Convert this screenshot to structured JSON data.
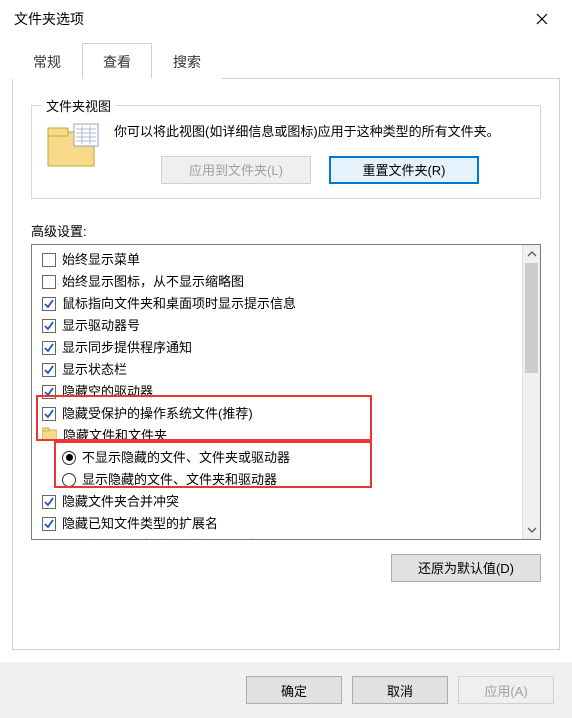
{
  "title": "文件夹选项",
  "tabs": {
    "general": "常规",
    "view": "查看",
    "search": "搜索"
  },
  "group": {
    "label": "文件夹视图",
    "desc": "你可以将此视图(如详细信息或图标)应用于这种类型的所有文件夹。",
    "apply_btn": "应用到文件夹(L)",
    "reset_btn": "重置文件夹(R)"
  },
  "advanced_label": "高级设置:",
  "items": [
    {
      "type": "check",
      "checked": false,
      "label": "始终显示菜单"
    },
    {
      "type": "check",
      "checked": false,
      "label": "始终显示图标，从不显示缩略图"
    },
    {
      "type": "check",
      "checked": true,
      "label": "鼠标指向文件夹和桌面项时显示提示信息"
    },
    {
      "type": "check",
      "checked": true,
      "label": "显示驱动器号"
    },
    {
      "type": "check",
      "checked": true,
      "label": "显示同步提供程序通知"
    },
    {
      "type": "check",
      "checked": true,
      "label": "显示状态栏"
    },
    {
      "type": "check",
      "checked": true,
      "label": "隐藏空的驱动器"
    },
    {
      "type": "check",
      "checked": true,
      "label": "隐藏受保护的操作系统文件(推荐)",
      "hl": 1
    },
    {
      "type": "folder",
      "label": "隐藏文件和文件夹",
      "hl": 1
    },
    {
      "type": "radio",
      "checked": true,
      "label": "不显示隐藏的文件、文件夹或驱动器",
      "indent": 1,
      "hl": 2
    },
    {
      "type": "radio",
      "checked": false,
      "label": "显示隐藏的文件、文件夹和驱动器",
      "indent": 1,
      "hl": 2
    },
    {
      "type": "check",
      "checked": true,
      "label": "隐藏文件夹合并冲突"
    },
    {
      "type": "check",
      "checked": true,
      "label": "隐藏已知文件类型的扩展名"
    },
    {
      "type": "check",
      "checked": false,
      "label": "用彩色显示加密或压缩的 NTFS 文件"
    }
  ],
  "restore_btn": "还原为默认值(D)",
  "footer": {
    "ok": "确定",
    "cancel": "取消",
    "apply": "应用(A)"
  }
}
